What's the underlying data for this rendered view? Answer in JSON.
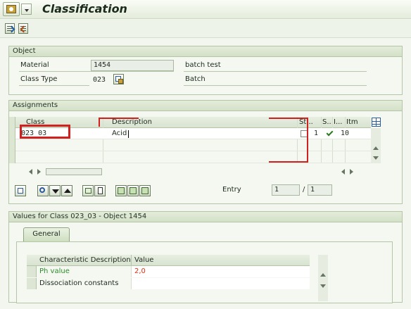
{
  "window": {
    "title": "Classification"
  },
  "toolbar": {
    "icons": [
      "save-icon",
      "display-icon"
    ]
  },
  "object_group": {
    "title": "Object",
    "material": {
      "label": "Material",
      "value": "1454",
      "description": "batch test"
    },
    "class_type": {
      "label": "Class Type",
      "value": "023",
      "description": "Batch"
    }
  },
  "assignments": {
    "title": "Assignments",
    "columns": [
      "Class",
      "Description",
      "St...",
      "S..",
      "I...",
      "Itm"
    ],
    "rows": [
      {
        "class": "023_03",
        "description": "Acid",
        "status_checked": false,
        "s": "1",
        "i_ok": true,
        "itm": "10"
      }
    ],
    "entry": {
      "label": "Entry",
      "value": "1",
      "slash": "/",
      "total": "1"
    },
    "icons": [
      "selection-icon",
      "search-icon",
      "arrow-down-icon",
      "arrow-up-icon",
      "insert-icon",
      "delete-icon",
      "detail-icon",
      "list-icon",
      "object-icon"
    ],
    "highlight_color": "#d0201f"
  },
  "values": {
    "title": "Values for Class 023_03 - Object 1454",
    "tab_label": "General",
    "columns": [
      "Characteristic Description",
      "Value"
    ],
    "rows": [
      {
        "characteristic": "Ph value",
        "value": "2,0"
      },
      {
        "characteristic": "Dissociation constants",
        "value": ""
      }
    ],
    "value_color": "#e03010"
  }
}
